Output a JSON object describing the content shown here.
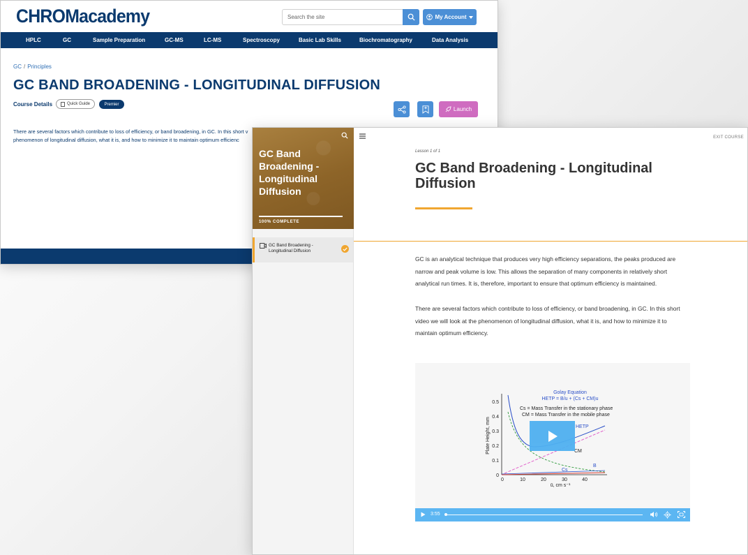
{
  "site": {
    "logo": "CHROMacademy",
    "search": {
      "placeholder": "Search the site"
    },
    "account_label": "My Account",
    "nav": [
      "HPLC",
      "GC",
      "Sample Preparation",
      "GC-MS",
      "LC-MS",
      "Spectroscopy",
      "Basic Lab Skills",
      "Biochromatography",
      "Data Analysis"
    ],
    "breadcrumb": [
      "GC",
      "Principles"
    ],
    "title": "GC BAND BROADENING - LONGITUDINAL DIFFUSION",
    "course_details_label": "Course Details",
    "quick_guide_label": "Quick Guide",
    "premier_label": "Premier",
    "launch_label": "Launch",
    "intro_lines": [
      "There are several factors which contribute to loss of efficiency, or band broadening, in GC. In this short v",
      "phenomenon of longitudinal diffusion, what it is, and how to minimize it to maintain optimum efficienc"
    ],
    "colors": {
      "primary": "#0b3a6e",
      "button": "#4b8fd6",
      "launch": "#cf6cc0"
    }
  },
  "player": {
    "sidebar": {
      "course_title": "GC Band Broadening - Longitudinal Diffusion",
      "progress_label": "100% COMPLETE",
      "progress": 1.0,
      "lesson_label": "GC Band Broadening - Longitudinal Diffusion",
      "lesson_completed": true
    },
    "exit_label": "EXIT COURSE",
    "lesson_counter": "Lesson 1 of 1",
    "lesson_title": "GC Band Broadening - Longitudinal Diffusion",
    "paragraphs": [
      "GC is an analytical technique that produces very high efficiency separations, the peaks produced are narrow and peak volume is low. This allows the separation of many components in relatively short analytical run times. It is, therefore, important to ensure that optimum efficiency is maintained.",
      "There are several factors which contribute to loss of efficiency, or band broadening, in GC. In this short video we will look at the phenomenon of longitudinal diffusion, what it is, and how to minimize it to maintain optimum efficiency."
    ],
    "video": {
      "time": "3:55",
      "chart_title": "Golay Equation",
      "equation": "HETP = B/u  +  (Cs + CM)u",
      "legend_cs": "Cs = Mass Transfer in the stationary phase",
      "legend_cm": "CM = Mass Transfer in the mobile phase",
      "ylabel": "Plate Height, mm",
      "xlabel": "ū, cm s⁻¹",
      "y_ticks": [
        "0",
        "0.1",
        "0.2",
        "0.3",
        "0.4",
        "0.5"
      ],
      "x_ticks": [
        "0",
        "10",
        "20",
        "30",
        "40"
      ],
      "curve_labels": {
        "hetp": "HETP",
        "cm": "CM",
        "cs": "Cs",
        "b": "B"
      },
      "colors": {
        "hetp": "#2a4fc8",
        "cm": "#e055c8",
        "cs": "#2e9a3c",
        "b": "#2a4fc8",
        "baseline": "#d0372c",
        "controls": "#5cb6f2"
      }
    },
    "colors": {
      "accent": "#f0a630",
      "sidebar_hero": "#8d6428"
    }
  }
}
